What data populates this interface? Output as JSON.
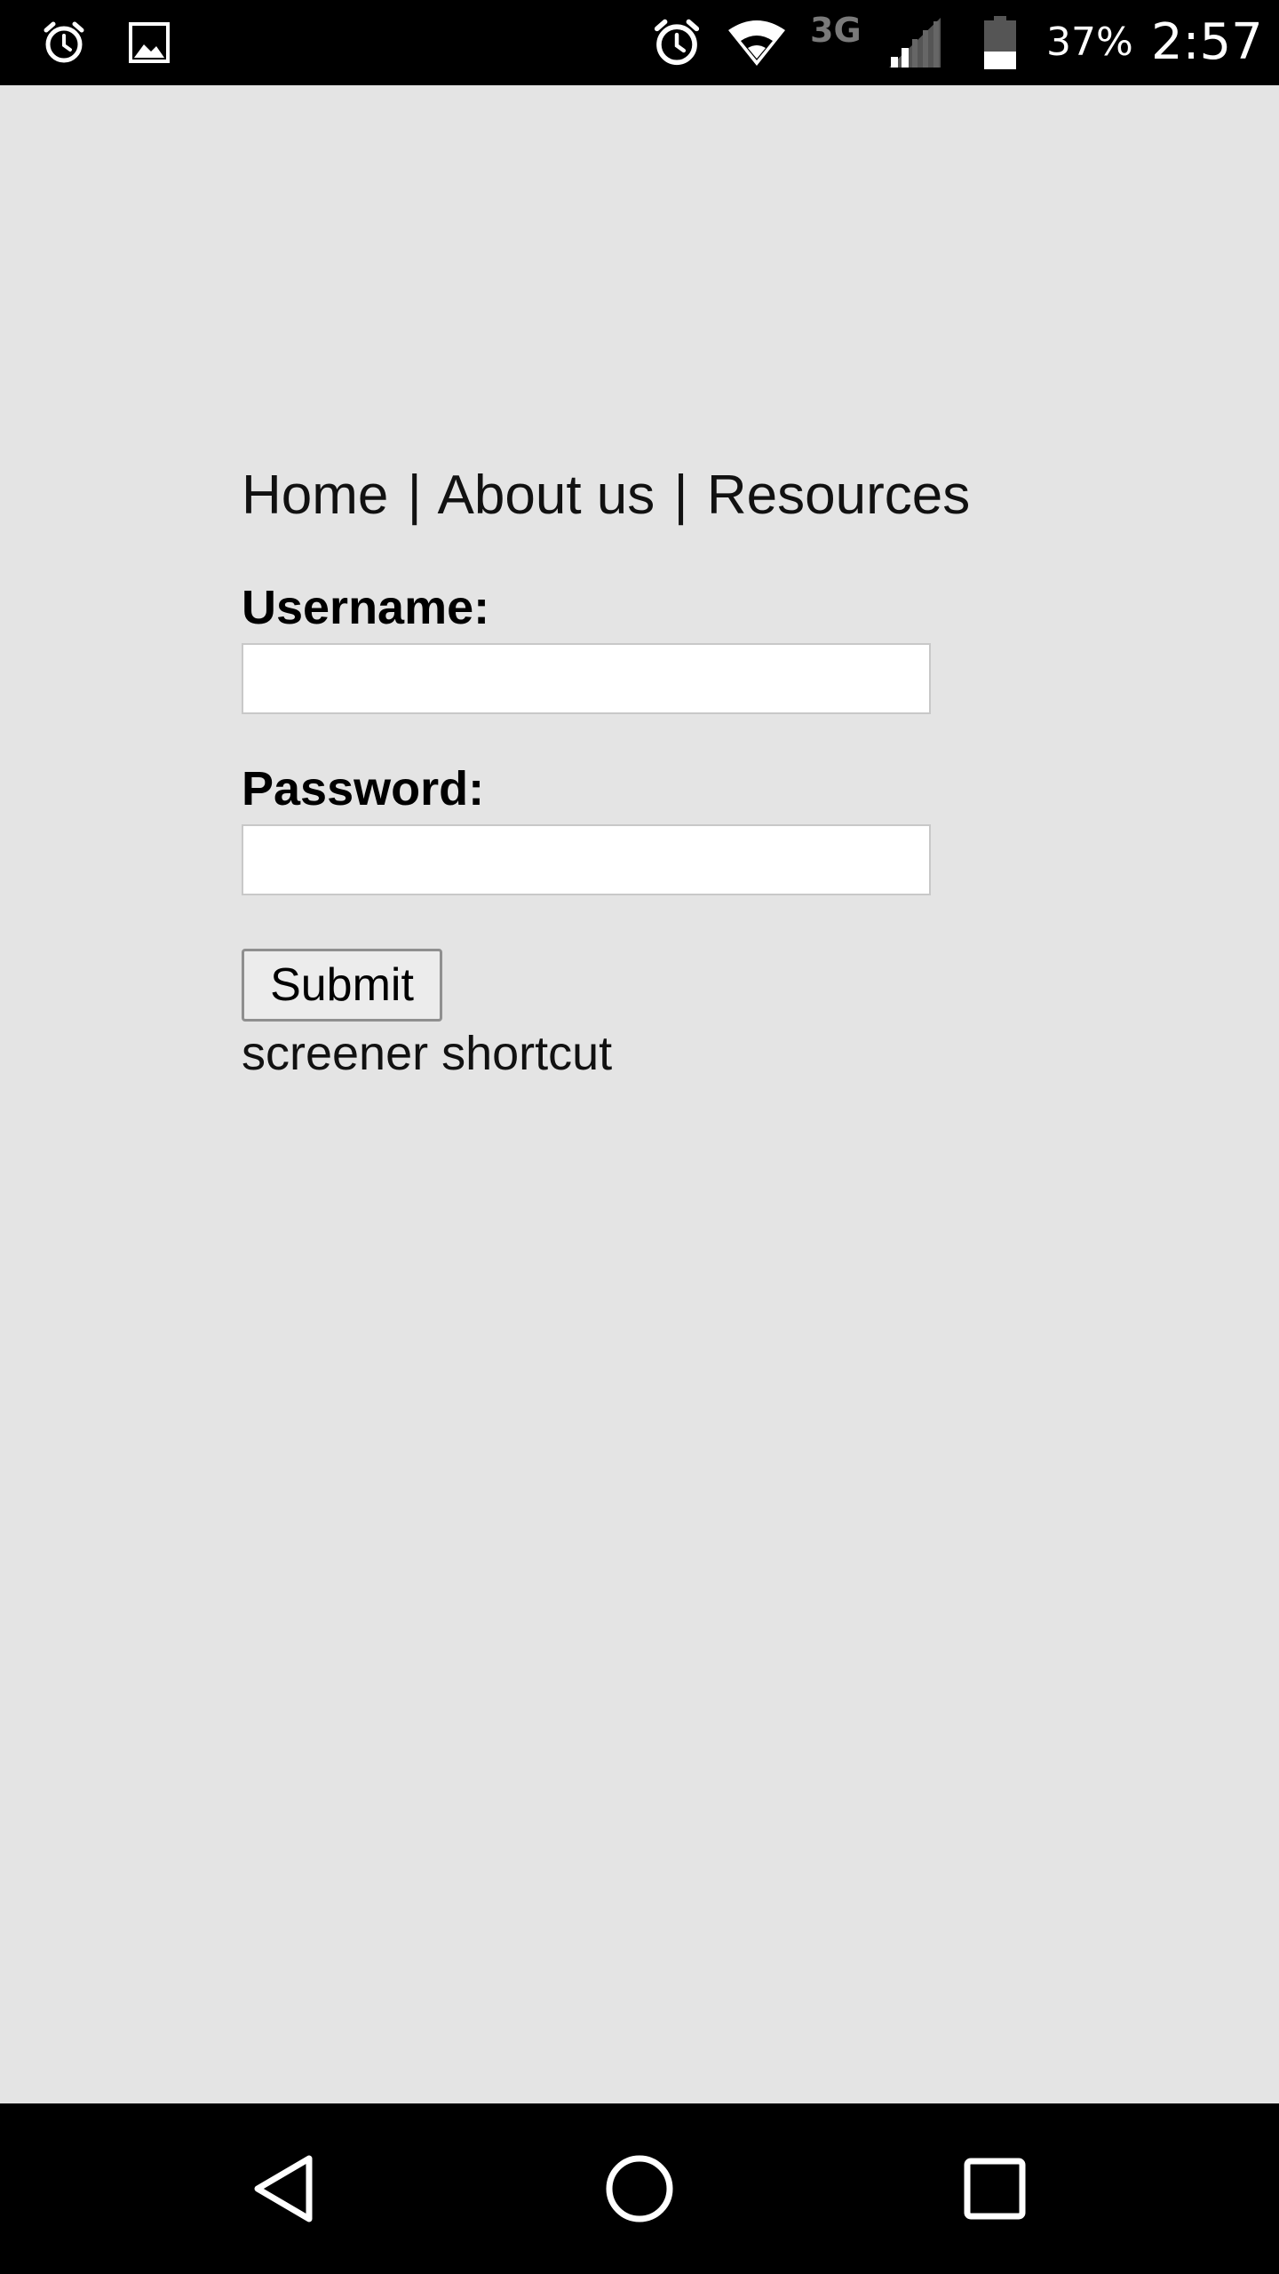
{
  "status_bar": {
    "left_icons": [
      "alarm-icon",
      "image-notification-icon"
    ],
    "right_icons": [
      "alarm-icon",
      "wifi-icon",
      "3g-icon",
      "signal-icon",
      "battery-icon"
    ],
    "network_type": "3G",
    "battery_percent": "37%",
    "battery_level": 0.37,
    "time": "2:57"
  },
  "nav_links": {
    "items": [
      "Home",
      "About us",
      "Resources"
    ],
    "separator": "|"
  },
  "form": {
    "username_label": "Username:",
    "username_value": "",
    "password_label": "Password:",
    "password_value": "",
    "submit_label": "Submit"
  },
  "shortcut_link": "screener shortcut",
  "navigation_bar": {
    "buttons": [
      "back-icon",
      "home-icon",
      "recents-icon"
    ]
  },
  "colors": {
    "page_background": "#e4e4e4",
    "bars": "#000000",
    "input_background": "#ffffff"
  }
}
